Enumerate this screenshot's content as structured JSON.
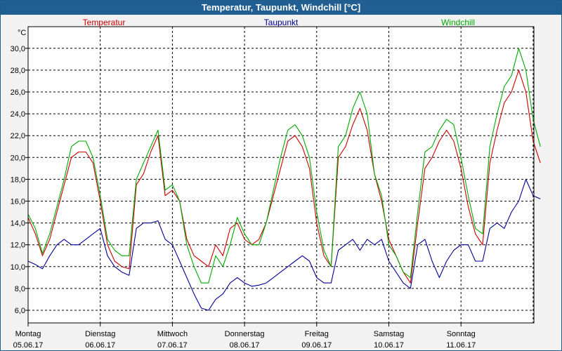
{
  "window_title": "Temperatur, Taupunkt, Windchill [°C]",
  "chart_data": {
    "type": "line",
    "unit_label": "°C",
    "ylim": [
      4.8,
      31.8
    ],
    "xlim": [
      0,
      7.0
    ],
    "grid": true,
    "y_ticks": [
      "6,0",
      "8,0",
      "10,0",
      "12,0",
      "14,0",
      "16,0",
      "18,0",
      "20,0",
      "22,0",
      "24,0",
      "26,0",
      "28,0",
      "30,0"
    ],
    "y_tick_values": [
      6,
      8,
      10,
      12,
      14,
      16,
      18,
      20,
      22,
      24,
      26,
      28,
      30
    ],
    "x_ticks": [
      {
        "day": "Montag",
        "date": "05.06.17",
        "x": 0
      },
      {
        "day": "Dienstag",
        "date": "06.06.17",
        "x": 1
      },
      {
        "day": "Mittwoch",
        "date": "07.06.17",
        "x": 2
      },
      {
        "day": "Donnerstag",
        "date": "08.06.17",
        "x": 3
      },
      {
        "day": "Freitag",
        "date": "09.06.17",
        "x": 4
      },
      {
        "day": "Samstag",
        "date": "10.06.17",
        "x": 5
      },
      {
        "day": "Sonntag",
        "date": "11.06.17",
        "x": 6
      }
    ],
    "series": [
      {
        "name": "Temperatur",
        "color": "#cc0000",
        "points": [
          [
            0,
            14.5
          ],
          [
            0.1,
            13.0
          ],
          [
            0.2,
            11.0
          ],
          [
            0.3,
            12.5
          ],
          [
            0.4,
            15.0
          ],
          [
            0.5,
            17.5
          ],
          [
            0.6,
            20.0
          ],
          [
            0.7,
            20.5
          ],
          [
            0.8,
            20.5
          ],
          [
            0.9,
            19.5
          ],
          [
            1.0,
            16.0
          ],
          [
            1.1,
            12.0
          ],
          [
            1.2,
            10.5
          ],
          [
            1.3,
            10.0
          ],
          [
            1.4,
            9.8
          ],
          [
            1.5,
            17.5
          ],
          [
            1.6,
            18.5
          ],
          [
            1.7,
            20.5
          ],
          [
            1.8,
            22.0
          ],
          [
            1.9,
            16.5
          ],
          [
            2.0,
            17.0
          ],
          [
            2.1,
            16.0
          ],
          [
            2.2,
            12.5
          ],
          [
            2.3,
            11.0
          ],
          [
            2.4,
            10.5
          ],
          [
            2.5,
            10.0
          ],
          [
            2.6,
            12.0
          ],
          [
            2.7,
            11.0
          ],
          [
            2.8,
            13.5
          ],
          [
            2.9,
            14.0
          ],
          [
            3.0,
            12.5
          ],
          [
            3.1,
            12.0
          ],
          [
            3.2,
            12.5
          ],
          [
            3.3,
            14.0
          ],
          [
            3.4,
            16.5
          ],
          [
            3.5,
            19.0
          ],
          [
            3.6,
            21.5
          ],
          [
            3.7,
            22.0
          ],
          [
            3.8,
            21.0
          ],
          [
            3.9,
            19.0
          ],
          [
            4.0,
            14.0
          ],
          [
            4.1,
            11.0
          ],
          [
            4.2,
            10.0
          ],
          [
            4.3,
            20.0
          ],
          [
            4.4,
            21.0
          ],
          [
            4.5,
            23.0
          ],
          [
            4.6,
            24.5
          ],
          [
            4.7,
            22.5
          ],
          [
            4.8,
            18.5
          ],
          [
            4.9,
            16.0
          ],
          [
            5.0,
            12.5
          ],
          [
            5.1,
            11.0
          ],
          [
            5.2,
            9.5
          ],
          [
            5.3,
            8.5
          ],
          [
            5.4,
            14.0
          ],
          [
            5.5,
            19.0
          ],
          [
            5.6,
            20.0
          ],
          [
            5.7,
            21.5
          ],
          [
            5.8,
            22.5
          ],
          [
            5.9,
            21.5
          ],
          [
            6.0,
            19.0
          ],
          [
            6.1,
            15.5
          ],
          [
            6.2,
            13.0
          ],
          [
            6.3,
            12.0
          ],
          [
            6.4,
            19.5
          ],
          [
            6.5,
            22.5
          ],
          [
            6.6,
            25.0
          ],
          [
            6.7,
            26.0
          ],
          [
            6.8,
            28.0
          ],
          [
            6.9,
            26.0
          ],
          [
            7.0,
            21.5
          ],
          [
            7.1,
            19.5
          ]
        ]
      },
      {
        "name": "Taupunkt",
        "color": "#000099",
        "points": [
          [
            0,
            10.5
          ],
          [
            0.1,
            10.2
          ],
          [
            0.2,
            9.8
          ],
          [
            0.3,
            11.0
          ],
          [
            0.4,
            12.0
          ],
          [
            0.5,
            12.5
          ],
          [
            0.6,
            12.0
          ],
          [
            0.7,
            12.0
          ],
          [
            0.8,
            12.5
          ],
          [
            0.9,
            13.0
          ],
          [
            1.0,
            13.5
          ],
          [
            1.1,
            11.0
          ],
          [
            1.2,
            10.0
          ],
          [
            1.3,
            9.5
          ],
          [
            1.4,
            9.2
          ],
          [
            1.5,
            13.5
          ],
          [
            1.6,
            14.0
          ],
          [
            1.7,
            14.0
          ],
          [
            1.8,
            14.2
          ],
          [
            1.9,
            12.5
          ],
          [
            2.0,
            12.0
          ],
          [
            2.1,
            10.5
          ],
          [
            2.2,
            9.0
          ],
          [
            2.3,
            7.5
          ],
          [
            2.4,
            6.2
          ],
          [
            2.5,
            6.0
          ],
          [
            2.6,
            7.0
          ],
          [
            2.7,
            7.5
          ],
          [
            2.8,
            8.5
          ],
          [
            2.9,
            9.0
          ],
          [
            3.0,
            8.5
          ],
          [
            3.1,
            8.2
          ],
          [
            3.2,
            8.3
          ],
          [
            3.3,
            8.5
          ],
          [
            3.4,
            9.0
          ],
          [
            3.5,
            9.5
          ],
          [
            3.6,
            10.0
          ],
          [
            3.7,
            10.5
          ],
          [
            3.8,
            11.0
          ],
          [
            3.9,
            10.5
          ],
          [
            4.0,
            9.0
          ],
          [
            4.1,
            8.5
          ],
          [
            4.2,
            8.5
          ],
          [
            4.3,
            11.5
          ],
          [
            4.4,
            12.0
          ],
          [
            4.5,
            12.5
          ],
          [
            4.6,
            11.5
          ],
          [
            4.7,
            12.5
          ],
          [
            4.8,
            12.0
          ],
          [
            4.9,
            12.5
          ],
          [
            5.0,
            10.5
          ],
          [
            5.1,
            9.5
          ],
          [
            5.2,
            8.5
          ],
          [
            5.3,
            8.0
          ],
          [
            5.4,
            12.0
          ],
          [
            5.5,
            12.5
          ],
          [
            5.6,
            10.5
          ],
          [
            5.7,
            9.0
          ],
          [
            5.8,
            10.5
          ],
          [
            5.9,
            11.5
          ],
          [
            6.0,
            12.0
          ],
          [
            6.1,
            12.0
          ],
          [
            6.2,
            10.5
          ],
          [
            6.3,
            10.5
          ],
          [
            6.4,
            13.5
          ],
          [
            6.5,
            14.0
          ],
          [
            6.6,
            13.5
          ],
          [
            6.7,
            15.0
          ],
          [
            6.8,
            16.0
          ],
          [
            6.9,
            18.0
          ],
          [
            7.0,
            16.5
          ],
          [
            7.1,
            16.2
          ]
        ]
      },
      {
        "name": "Windchill",
        "color": "#00aa00",
        "points": [
          [
            0,
            14.8
          ],
          [
            0.1,
            13.5
          ],
          [
            0.2,
            11.2
          ],
          [
            0.3,
            13.0
          ],
          [
            0.4,
            15.5
          ],
          [
            0.5,
            18.0
          ],
          [
            0.6,
            21.0
          ],
          [
            0.7,
            21.5
          ],
          [
            0.8,
            21.5
          ],
          [
            0.9,
            20.0
          ],
          [
            1.0,
            16.5
          ],
          [
            1.1,
            12.5
          ],
          [
            1.2,
            11.5
          ],
          [
            1.3,
            11.0
          ],
          [
            1.4,
            11.0
          ],
          [
            1.5,
            18.0
          ],
          [
            1.6,
            19.5
          ],
          [
            1.7,
            21.0
          ],
          [
            1.8,
            22.5
          ],
          [
            1.9,
            17.0
          ],
          [
            2.0,
            17.5
          ],
          [
            2.1,
            16.0
          ],
          [
            2.2,
            12.0
          ],
          [
            2.3,
            10.0
          ],
          [
            2.4,
            8.5
          ],
          [
            2.5,
            8.5
          ],
          [
            2.6,
            11.0
          ],
          [
            2.7,
            10.0
          ],
          [
            2.8,
            12.0
          ],
          [
            2.9,
            14.5
          ],
          [
            3.0,
            13.0
          ],
          [
            3.1,
            12.0
          ],
          [
            3.2,
            12.0
          ],
          [
            3.3,
            14.0
          ],
          [
            3.4,
            17.0
          ],
          [
            3.5,
            20.0
          ],
          [
            3.6,
            22.5
          ],
          [
            3.7,
            23.0
          ],
          [
            3.8,
            22.0
          ],
          [
            3.9,
            20.0
          ],
          [
            4.0,
            15.0
          ],
          [
            4.1,
            11.5
          ],
          [
            4.2,
            10.0
          ],
          [
            4.3,
            21.0
          ],
          [
            4.4,
            22.0
          ],
          [
            4.5,
            24.5
          ],
          [
            4.6,
            26.0
          ],
          [
            4.7,
            24.0
          ],
          [
            4.8,
            18.5
          ],
          [
            4.9,
            16.5
          ],
          [
            5.0,
            12.0
          ],
          [
            5.1,
            11.0
          ],
          [
            5.2,
            9.5
          ],
          [
            5.3,
            9.0
          ],
          [
            5.4,
            15.0
          ],
          [
            5.5,
            20.5
          ],
          [
            5.6,
            21.0
          ],
          [
            5.7,
            22.5
          ],
          [
            5.8,
            23.5
          ],
          [
            5.9,
            23.0
          ],
          [
            6.0,
            20.0
          ],
          [
            6.1,
            16.5
          ],
          [
            6.2,
            13.5
          ],
          [
            6.3,
            13.0
          ],
          [
            6.4,
            21.0
          ],
          [
            6.5,
            24.0
          ],
          [
            6.6,
            26.5
          ],
          [
            6.7,
            27.5
          ],
          [
            6.8,
            30.0
          ],
          [
            6.9,
            28.0
          ],
          [
            7.0,
            23.5
          ],
          [
            7.1,
            21.0
          ]
        ]
      }
    ]
  }
}
